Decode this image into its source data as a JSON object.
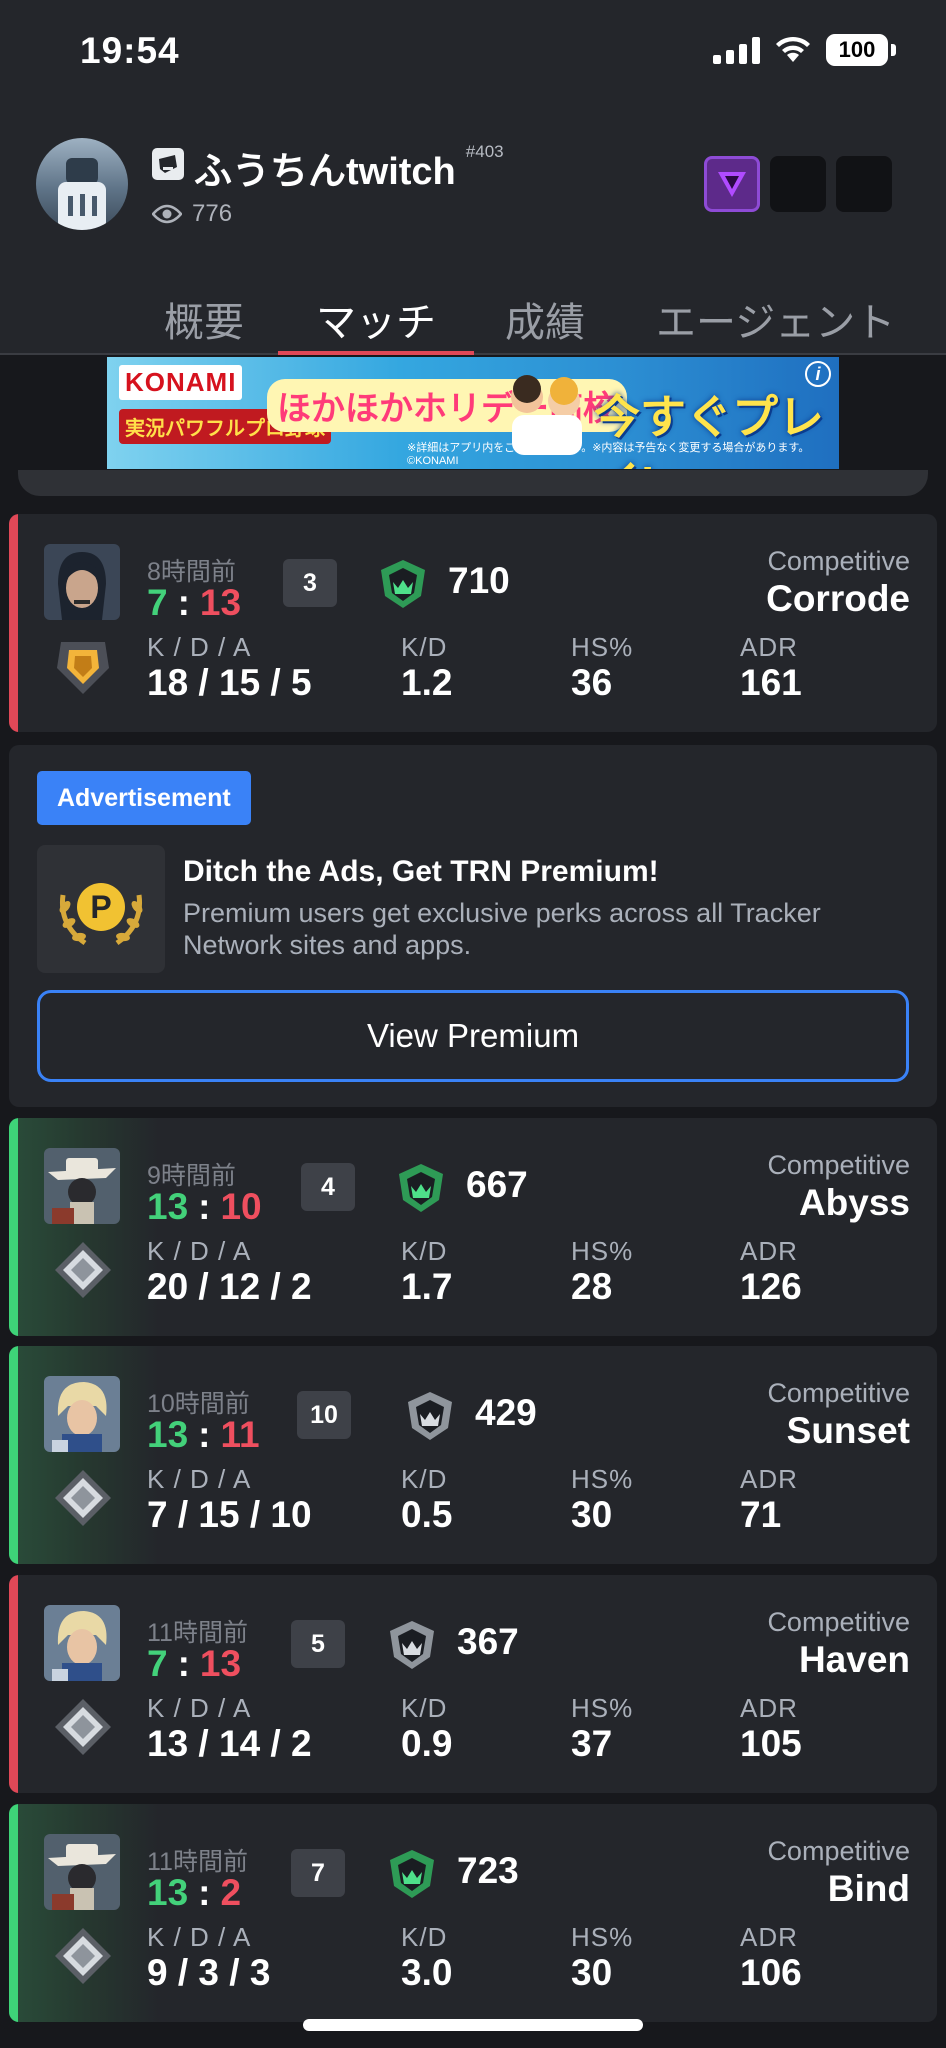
{
  "status_bar": {
    "time": "19:54",
    "battery": "100"
  },
  "profile": {
    "name": "ふうちんtwitch",
    "tag": "#403",
    "views": "776",
    "platform_icon": "riot-fist-icon",
    "badge_icon": "purple-triangle-icon",
    "accent": "#8e4bd6"
  },
  "tabs": [
    {
      "label": "概要"
    },
    {
      "label": "マッチ",
      "active": true
    },
    {
      "label": "成績"
    },
    {
      "label": "エージェント"
    }
  ],
  "banner_ad": {
    "brand": "KONAMI",
    "game": "実況パワフルプロ野球",
    "title": "ほかほかホリデー高校",
    "cta": "今すぐプレイ!",
    "note": "※詳細はアプリ内をご確認ください。※内容は予告なく変更する場合があります。 ©KONAMI",
    "info": "i"
  },
  "stat_labels": {
    "kda": "K / D / A",
    "kd": "K/D",
    "hs": "HS%",
    "adr": "ADR"
  },
  "matches": [
    {
      "result": "loss",
      "time_ago": "8時間前",
      "team_score": "7",
      "enemy_score": "13",
      "separator": ":",
      "placement": "3",
      "rr": "710",
      "mode": "Competitive",
      "map": "Corrode",
      "kda": "18 / 15 / 5",
      "kd": "1.2",
      "hs": "36",
      "adr": "161",
      "agent_icon": "agent-portrait-icon",
      "rank_icon": "gold-rank-icon"
    },
    {
      "result": "win",
      "time_ago": "9時間前",
      "team_score": "13",
      "enemy_score": "10",
      "separator": ":",
      "placement": "4",
      "rr": "667",
      "mode": "Competitive",
      "map": "Abyss",
      "kda": "20 / 12 / 2",
      "kd": "1.7",
      "hs": "28",
      "adr": "126",
      "agent_icon": "agent-portrait-icon",
      "rank_icon": "platinum-rank-icon"
    },
    {
      "result": "win",
      "time_ago": "10時間前",
      "team_score": "13",
      "enemy_score": "11",
      "separator": ":",
      "placement": "10",
      "rr": "429",
      "mode": "Competitive",
      "map": "Sunset",
      "kda": "7 / 15 / 10",
      "kd": "0.5",
      "hs": "30",
      "adr": "71",
      "agent_icon": "agent-portrait-icon",
      "rank_icon": "platinum-rank-icon"
    },
    {
      "result": "loss",
      "time_ago": "11時間前",
      "team_score": "7",
      "enemy_score": "13",
      "separator": ":",
      "placement": "5",
      "rr": "367",
      "mode": "Competitive",
      "map": "Haven",
      "kda": "13 / 14 / 2",
      "kd": "0.9",
      "hs": "37",
      "adr": "105",
      "agent_icon": "agent-portrait-icon",
      "rank_icon": "platinum-rank-icon"
    },
    {
      "result": "win",
      "time_ago": "11時間前",
      "team_score": "13",
      "enemy_score": "2",
      "separator": ":",
      "placement": "7",
      "rr": "723",
      "mode": "Competitive",
      "map": "Bind",
      "kda": "9 / 3 / 3",
      "kd": "3.0",
      "hs": "30",
      "adr": "106",
      "agent_icon": "agent-portrait-icon",
      "rank_icon": "platinum-rank-icon"
    }
  ],
  "premium_ad": {
    "badge": "Advertisement",
    "title": "Ditch the Ads, Get TRN Premium!",
    "description": "Premium users get exclusive perks across all Tracker Network sites and apps.",
    "button": "View Premium",
    "logo_icon": "premium-laurel-icon",
    "logo_letter": "P",
    "accent": "#3a82f7"
  },
  "colors": {
    "win": "#3ed478",
    "loss": "#e04857",
    "win_score": "#43d17a",
    "loss_score": "#ef4f5f"
  }
}
